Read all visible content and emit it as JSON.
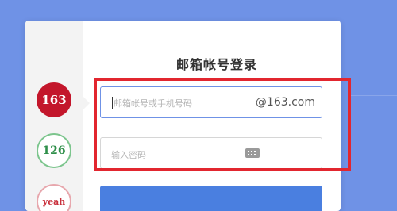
{
  "login": {
    "title": "邮箱帐号登录",
    "email_placeholder": "邮箱帐号或手机号码",
    "email_suffix": "@163.com",
    "password_placeholder": "输入密码"
  },
  "providers": [
    {
      "label": "163",
      "color": "#c3162b"
    },
    {
      "label": "126",
      "color": "#2f8f4a"
    },
    {
      "label": "yeah",
      "color": "#c9303c"
    }
  ],
  "icons": {
    "keyboard": "keyboard-icon"
  },
  "colors": {
    "background": "#6f92e6",
    "highlight": "#e2262f",
    "button": "#4a7fe0"
  }
}
